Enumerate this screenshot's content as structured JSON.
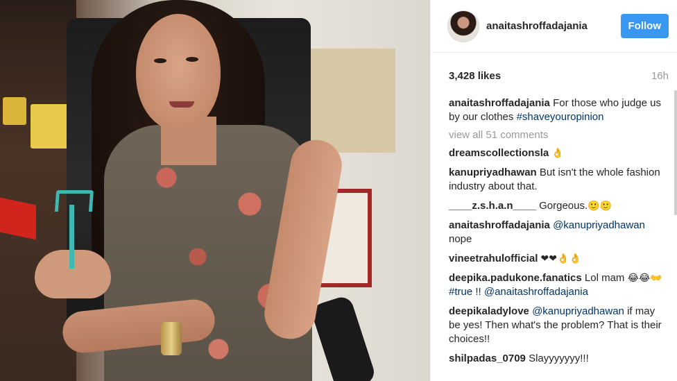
{
  "post": {
    "username": "anaitashroffadajania",
    "follow_label": "Follow",
    "likes": "3,428 likes",
    "time": "16h"
  },
  "caption": {
    "user": "anaitashroffadajania",
    "text": "For those who judge us by our clothes",
    "hashtag": "#shaveyouropinion"
  },
  "view_all": "view all 51 comments",
  "comments": [
    {
      "user": "dreamscollectionsla",
      "text": "",
      "link": "",
      "emoji": "👌"
    },
    {
      "user": "kanupriyadhawan",
      "text": "But isn't the whole fashion industry about that.",
      "link": "",
      "emoji": ""
    },
    {
      "user": "____z.s.h.a.n____",
      "text": "Gorgeous.",
      "link": "",
      "emoji": "🙂🙂"
    },
    {
      "user": "anaitashroffadajania",
      "link": "@kanupriyadhawan",
      "text": "nope",
      "emoji": ""
    },
    {
      "user": "vineetrahulofficial",
      "text": "",
      "link": "",
      "emoji": "❤❤👌👌"
    },
    {
      "user": "deepika.padukone.fanatics",
      "text": "Lol mam",
      "emoji": "😂😂👐",
      "link": "#true !! @anaitashroffadajania"
    },
    {
      "user": "deepikaladylove",
      "link": "@kanupriyadhawan",
      "text": "if may be yes! Then what's the problem? That is their choices!!",
      "emoji": ""
    },
    {
      "user": "shilpadas_0709",
      "text": "Slayyyyyyy!!!",
      "link": "",
      "emoji": ""
    }
  ]
}
